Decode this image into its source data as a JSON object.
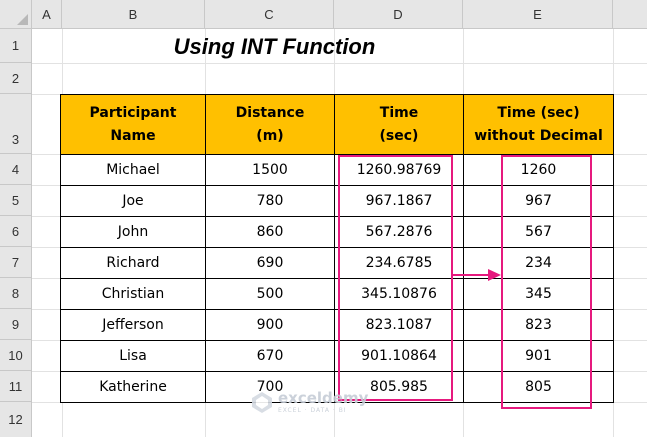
{
  "columns": [
    "A",
    "B",
    "C",
    "D",
    "E"
  ],
  "rows": [
    "1",
    "2",
    "3",
    "4",
    "5",
    "6",
    "7",
    "8",
    "9",
    "10",
    "11",
    "12"
  ],
  "title": "Using INT Function",
  "table": {
    "headers": [
      {
        "line1": "Participant",
        "line2": "Name"
      },
      {
        "line1": "Distance",
        "line2": "(m)"
      },
      {
        "line1": "Time",
        "line2": "(sec)"
      },
      {
        "line1": "Time (sec)",
        "line2": "without Decimal"
      }
    ],
    "rows": [
      [
        "Michael",
        "1500",
        "1260.98769",
        "1260"
      ],
      [
        "Joe",
        "780",
        "967.1867",
        "967"
      ],
      [
        "John",
        "860",
        "567.2876",
        "567"
      ],
      [
        "Richard",
        "690",
        "234.6785",
        "234"
      ],
      [
        "Christian",
        "500",
        "345.10876",
        "345"
      ],
      [
        "Jefferson",
        "900",
        "823.1087",
        "823"
      ],
      [
        "Lisa",
        "670",
        "901.10864",
        "901"
      ],
      [
        "Katherine",
        "700",
        "805.985",
        "805"
      ]
    ]
  },
  "watermark": {
    "name": "exceldemy",
    "tagline": "EXCEL · DATA · BI"
  },
  "colors": {
    "header_fill": "#ffc000",
    "highlight": "#e6197e",
    "grid": "#e2e2e2",
    "heading_bg": "#e6e6e6"
  }
}
